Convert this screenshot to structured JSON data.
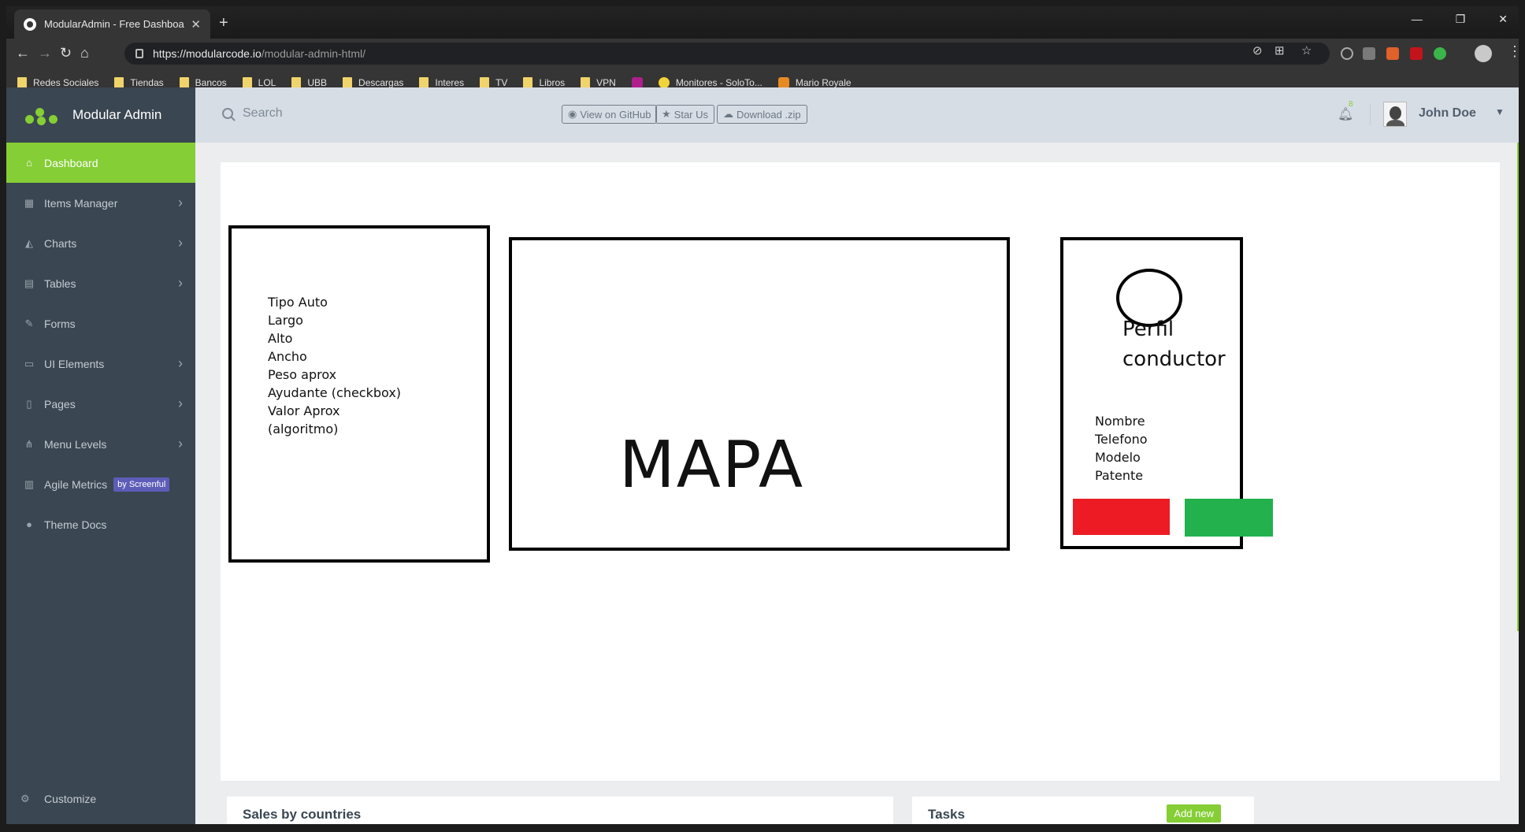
{
  "browser": {
    "tab_title": "ModularAdmin - Free Dashboard",
    "tab_close": "✕",
    "new_tab": "+",
    "url_host": "https://modularcode.io",
    "url_path": "/modular-admin-html/",
    "window_controls": [
      "—",
      "❐",
      "✕"
    ],
    "bookmarks": [
      {
        "label": "Redes Sociales",
        "icon": "folder-icon"
      },
      {
        "label": "Tiendas",
        "icon": "folder-icon"
      },
      {
        "label": "Bancos",
        "icon": "folder-icon"
      },
      {
        "label": "LOL",
        "icon": "folder-icon"
      },
      {
        "label": "UBB",
        "icon": "folder-icon"
      },
      {
        "label": "Descargas",
        "icon": "folder-icon"
      },
      {
        "label": "Interes",
        "icon": "folder-icon"
      },
      {
        "label": "TV",
        "icon": "folder-icon"
      },
      {
        "label": "Libros",
        "icon": "folder-icon"
      },
      {
        "label": "VPN",
        "icon": "folder-icon"
      },
      {
        "label": "",
        "icon": "site-icon"
      },
      {
        "label": "Monitores - SoloTo...",
        "icon": "site-icon"
      },
      {
        "label": "Mario Royale",
        "icon": "site-icon"
      }
    ]
  },
  "sidebar": {
    "brand": "Modular Admin",
    "items": [
      {
        "label": "Dashboard",
        "icon": "home-icon",
        "glyph": "⌂",
        "active": true,
        "chevron": false
      },
      {
        "label": "Items Manager",
        "icon": "grid-icon",
        "glyph": "▦",
        "active": false,
        "chevron": true
      },
      {
        "label": "Charts",
        "icon": "area-chart-icon",
        "glyph": "◭",
        "active": false,
        "chevron": true
      },
      {
        "label": "Tables",
        "icon": "table-icon",
        "glyph": "▤",
        "active": false,
        "chevron": true
      },
      {
        "label": "Forms",
        "icon": "edit-icon",
        "glyph": "✎",
        "active": false,
        "chevron": false
      },
      {
        "label": "UI Elements",
        "icon": "desktop-icon",
        "glyph": "▭",
        "active": false,
        "chevron": true
      },
      {
        "label": "Pages",
        "icon": "file-icon",
        "glyph": "▯",
        "active": false,
        "chevron": true
      },
      {
        "label": "Menu Levels",
        "icon": "sitemap-icon",
        "glyph": "⋔",
        "active": false,
        "chevron": true
      },
      {
        "label": "Agile Metrics",
        "icon": "bar-chart-icon",
        "glyph": "▥",
        "active": false,
        "chevron": false,
        "badge": "by Screenful"
      },
      {
        "label": "Theme Docs",
        "icon": "github-icon",
        "glyph": "●",
        "active": false,
        "chevron": false
      }
    ],
    "customize": "Customize"
  },
  "header": {
    "search_placeholder": "Search",
    "github_button": "View on GitHub",
    "star_button": "Star Us",
    "download_button": "Download .zip",
    "notification_count": "8",
    "user_name": "John Doe"
  },
  "sketch": {
    "left_panel_lines": [
      "Tipo Auto",
      "Largo",
      "Alto",
      "Ancho",
      "Peso aprox",
      "Ayudante (checkbox)",
      "Valor Aprox",
      "(algoritmo)"
    ],
    "map_label": "MAPA",
    "profile_title_line1": "Perfil",
    "profile_title_line2": "conductor",
    "profile_fields": [
      "Nombre",
      "Telefono",
      "Modelo",
      "Patente"
    ],
    "reject_color": "#ed1c24",
    "accept_color": "#22b14c"
  },
  "cards": {
    "sales_title": "Sales by countries",
    "tasks_title": "Tasks",
    "add_new": "Add new"
  },
  "colors": {
    "accent": "#85ce36",
    "sidebar_bg": "#3a4651",
    "header_bg": "#d7dde4",
    "badge": "#5d5cb8"
  }
}
